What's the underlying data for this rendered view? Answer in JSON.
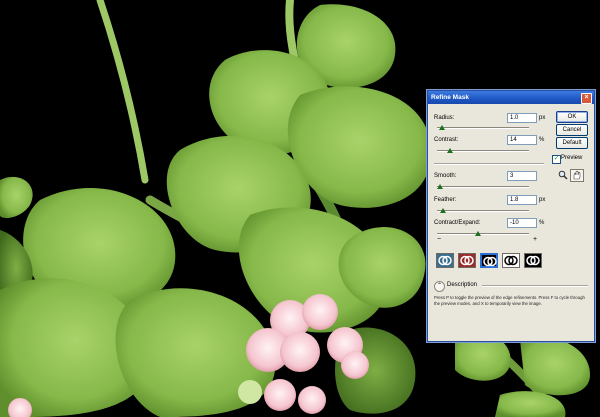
{
  "dialog": {
    "title": "Refine Mask",
    "close_glyph": "×",
    "fields": [
      {
        "label": "Radius:",
        "value": "1.0",
        "unit": "px",
        "slider_fraction": 0.05
      },
      {
        "label": "Contrast:",
        "value": "14",
        "unit": "%",
        "slider_fraction": 0.14
      },
      {
        "label": "Smooth:",
        "value": "3",
        "unit": "",
        "slider_fraction": 0.03
      },
      {
        "label": "Feather:",
        "value": "1.8",
        "unit": "px",
        "slider_fraction": 0.07
      },
      {
        "label": "Contract/Expand:",
        "value": "-10",
        "unit": "%",
        "slider_fraction": 0.45
      }
    ],
    "minus_label": "−",
    "plus_label": "+",
    "buttons": {
      "ok": "OK",
      "cancel": "Cancel",
      "default": "Default"
    },
    "preview": {
      "label": "Preview",
      "checked": true
    },
    "tools": [
      "zoom-icon",
      "hand-icon"
    ],
    "preview_modes": [
      {
        "name": "standard",
        "bg": "#3a6e90",
        "selected": false
      },
      {
        "name": "quick-mask",
        "bg": "#9b2b2b",
        "selected": false
      },
      {
        "name": "on-black",
        "bg": "#000000",
        "selected": true
      },
      {
        "name": "on-white",
        "bg": "#ffffff",
        "selected": false
      },
      {
        "name": "mask",
        "bg": "#000000",
        "selected": false
      }
    ],
    "description": {
      "label": "Description",
      "text": "Press P to toggle the preview of the edge refinements. Press F to cycle through the preview modes, and X to temporarily view the image."
    }
  },
  "colors": {
    "titlebar": "#1f57c4",
    "dialog_bg": "#e9e6dc",
    "slider_thumb": "#1d6f1d",
    "background": "#000000",
    "leaf": "#86b84a"
  }
}
